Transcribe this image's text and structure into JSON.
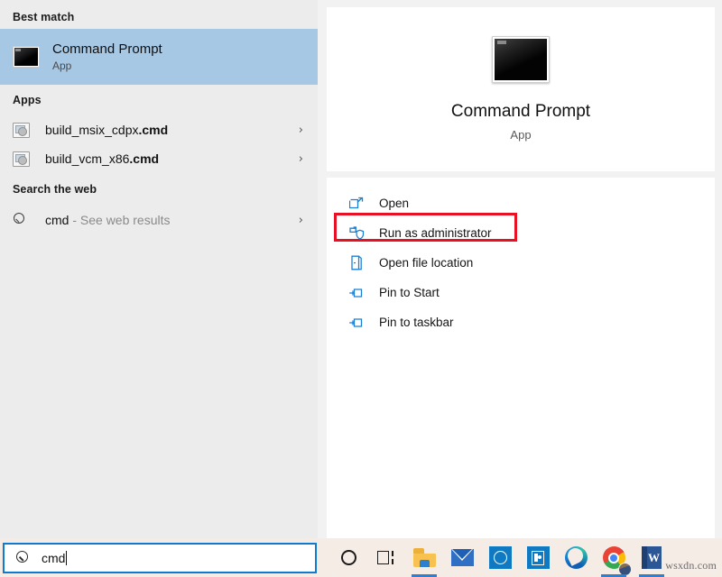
{
  "search_pane": {
    "groups": [
      {
        "header": "Best match",
        "items": [
          {
            "title": "Command Prompt",
            "subtitle": "App",
            "icon": "console-icon",
            "type": "best-match"
          }
        ]
      },
      {
        "header": "Apps",
        "items": [
          {
            "label_plain": "build_msix_cdpx",
            "label_bold": ".cmd",
            "icon": "cmd-script-icon",
            "chevron": "›"
          },
          {
            "label_plain": "build_vcm_x86",
            "label_bold": ".cmd",
            "icon": "cmd-script-icon",
            "chevron": "›"
          }
        ]
      },
      {
        "header": "Search the web",
        "items": [
          {
            "label_plain": "cmd",
            "label_dim": " - See web results",
            "icon": "search-icon",
            "chevron": "›"
          }
        ]
      }
    ]
  },
  "preview_pane": {
    "app_title": "Command Prompt",
    "app_type": "App",
    "app_icon": "console-icon",
    "actions": [
      {
        "label": "Open",
        "icon": "open-external-icon"
      },
      {
        "label": "Run as administrator",
        "icon": "shield-icon",
        "highlighted": true
      },
      {
        "label": "Open file location",
        "icon": "folder-page-icon"
      },
      {
        "label": "Pin to Start",
        "icon": "pin-icon"
      },
      {
        "label": "Pin to taskbar",
        "icon": "pin-icon"
      }
    ]
  },
  "annotation": {
    "highlight_color": "#e81123",
    "target_label": "Run as administrator"
  },
  "taskbar": {
    "search": {
      "value": "cmd",
      "placeholder": "Type here to search",
      "icon": "search-icon",
      "border_color": "#0f7ad0"
    },
    "buttons": [
      {
        "name": "cortana",
        "icon": "cortana-circle-icon",
        "running": false
      },
      {
        "name": "task-view",
        "icon": "task-view-icon",
        "running": false
      },
      {
        "name": "file-explorer",
        "icon": "file-explorer-icon",
        "running": true
      },
      {
        "name": "mail",
        "icon": "mail-icon",
        "running": false
      },
      {
        "name": "dell",
        "icon": "dell-icon",
        "running": false
      },
      {
        "name": "microsoft-store",
        "icon": "store-icon",
        "running": false
      },
      {
        "name": "microsoft-edge",
        "icon": "edge-icon",
        "running": false
      },
      {
        "name": "google-chrome",
        "icon": "chrome-icon",
        "running": true
      },
      {
        "name": "microsoft-word",
        "icon": "word-icon",
        "running": true
      }
    ]
  },
  "watermark": {
    "text": "wsxdn.com"
  },
  "colors": {
    "selection": "#a7c8e5",
    "results_bg": "#ececec",
    "preview_bg": "#f2f2f2",
    "taskbar_bg": "#f6ece6",
    "accent": "#0f7ad0",
    "annotation_red": "#e81123"
  }
}
